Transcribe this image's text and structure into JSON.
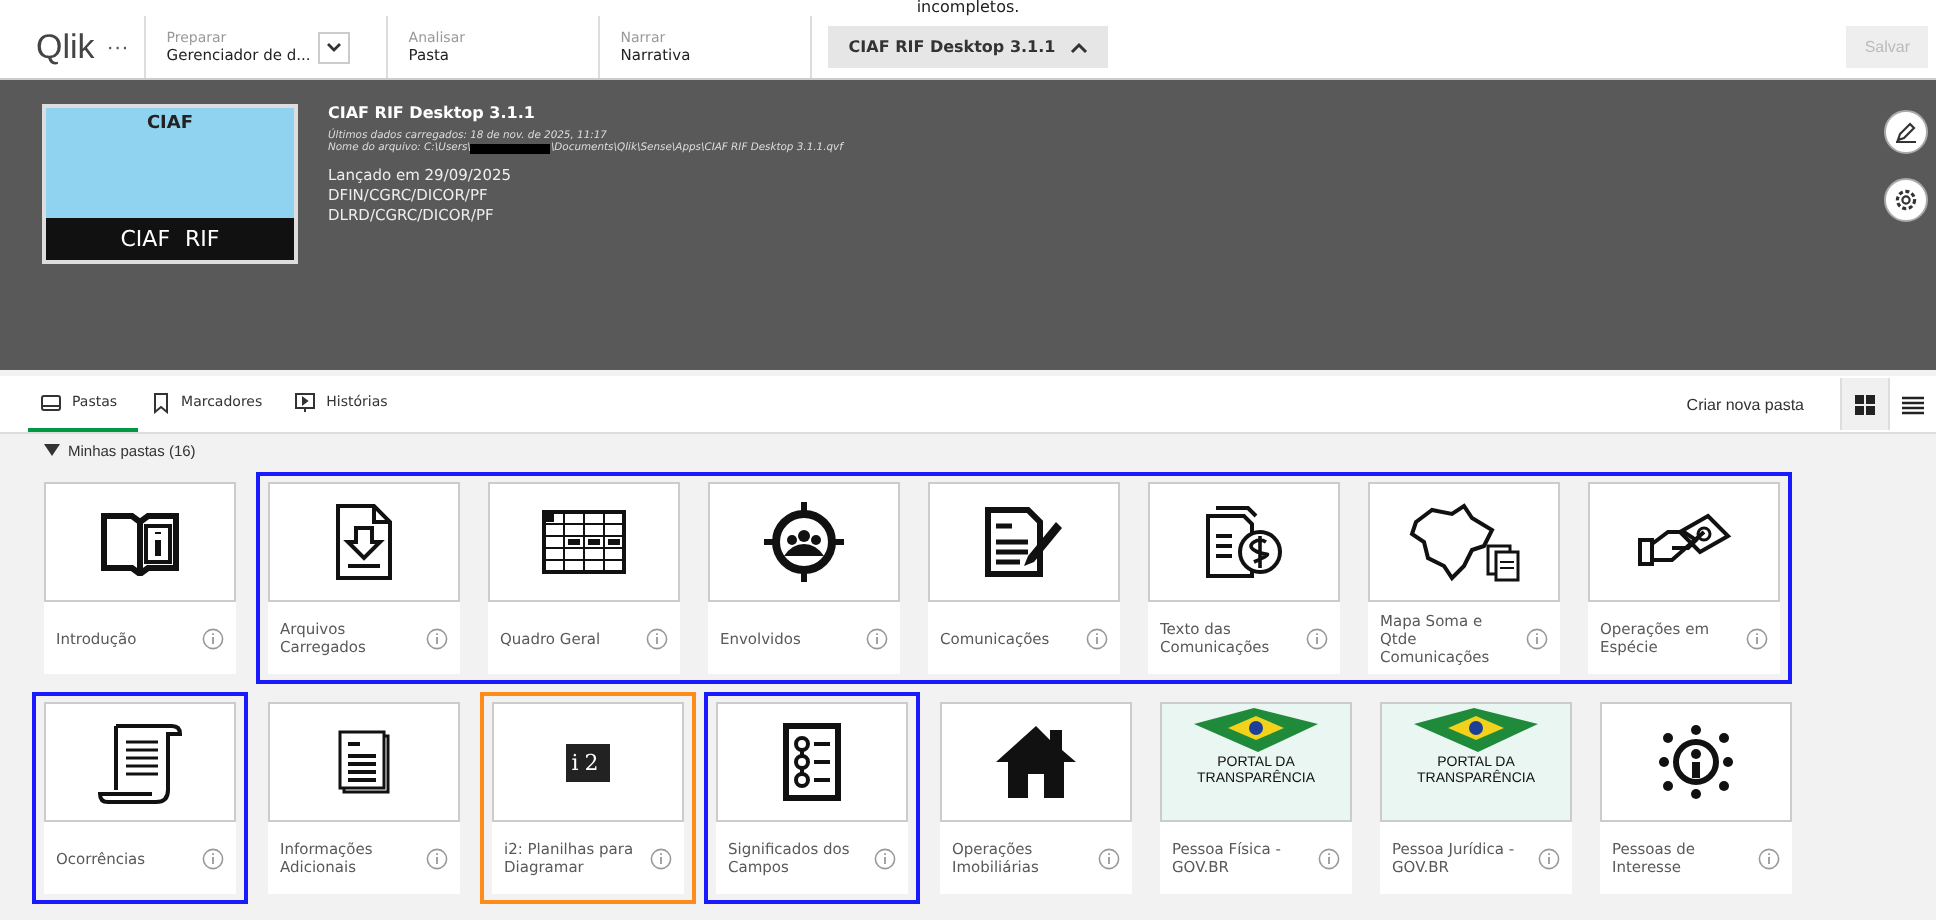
{
  "caption": "incompletos.",
  "toolbar": {
    "logo": "Qlik",
    "more": "···",
    "sections": [
      {
        "label": "Preparar",
        "value": "Gerenciador de d...",
        "dropdown": true
      },
      {
        "label": "Analisar",
        "value": "Pasta",
        "dropdown": false
      },
      {
        "label": "Narrar",
        "value": "Narrativa",
        "dropdown": false
      }
    ],
    "app_button": "CIAF RIF Desktop 3.1.1",
    "save": {
      "label": "Salvar",
      "disabled": true
    }
  },
  "header": {
    "logo_top": "CIAF",
    "logo_label": "CIAF RIF",
    "title": "CIAF RIF Desktop 3.1.1",
    "last_loaded": "Últimos dados carregados: 18 de nov. de 2025, 11:17",
    "file_prefix": "Nome do arquivo: C:\\Users\\",
    "file_suffix": "\\Documents\\Qlik\\Sense\\Apps\\CIAF RIF Desktop 3.1.1.qvf",
    "description": [
      "Lançado em 29/09/2025",
      "DFIN/CGRC/DICOR/PF",
      "DLRD/CGRC/DICOR/PF"
    ]
  },
  "tabs": [
    {
      "label": "Pastas",
      "selected": true
    },
    {
      "label": "Marcadores",
      "selected": false
    },
    {
      "label": "Histórias",
      "selected": false
    }
  ],
  "create_sheet": "Criar nova pasta",
  "views": [
    {
      "selected": true
    },
    {
      "selected": false
    }
  ],
  "section": {
    "title": "Minhas pastas (16)",
    "expanded": true
  },
  "rows": [
    {
      "groups": [
        {
          "sheets": [
            {
              "title": "Introdução"
            }
          ]
        },
        {
          "color": "#1a1aff",
          "sheets": [
            {
              "title": "Arquivos Carregados"
            },
            {
              "title": "Quadro Geral"
            },
            {
              "title": "Envolvidos"
            },
            {
              "title": "Comunicações"
            },
            {
              "title": "Texto das Comunicações"
            },
            {
              "title": "Mapa Soma e Qtde Comunicações"
            },
            {
              "title": "Operações em Espécie"
            }
          ]
        }
      ]
    },
    {
      "groups": [
        {
          "color": "#1a1aff",
          "sheets": [
            {
              "title": "Ocorrências"
            }
          ]
        },
        {
          "sheets": [
            {
              "title": "Informações Adicionais"
            }
          ]
        },
        {
          "color": "#ff8c1a",
          "sheets": [
            {
              "title": "i2: Planilhas para Diagramar",
              "thumbnail_text": "i2"
            }
          ]
        },
        {
          "color": "#1a1aff",
          "sheets": [
            {
              "title": "Significados dos Campos"
            }
          ]
        },
        {
          "sheets": [
            {
              "title": "Operações Imobiliárias"
            },
            {
              "title": "Pessoa Física - GOV.BR",
              "thumbnail_text": "PORTAL DA TRANSPARÊNCIA"
            },
            {
              "title": "Pessoa Jurídica - GOV.BR",
              "thumbnail_text": "PORTAL DA TRANSPARÊNCIA"
            },
            {
              "title": "Pessoas de Interesse"
            }
          ]
        }
      ]
    }
  ]
}
